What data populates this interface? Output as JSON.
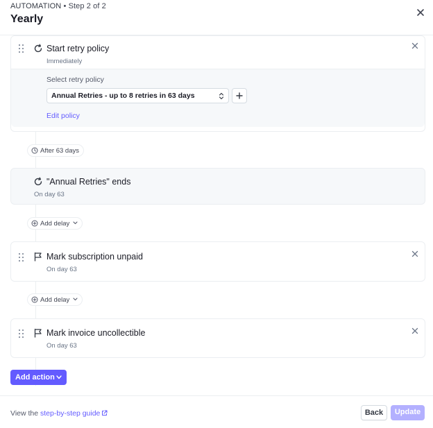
{
  "header": {
    "eyebrow_label": "AUTOMATION",
    "eyebrow_step": "• Step 2 of 2",
    "title": "Yearly"
  },
  "steps": {
    "retry": {
      "title": "Start retry policy",
      "subtitle": "Immediately",
      "select_label": "Select retry policy",
      "select_value": "Annual Retries - up to 8 retries in 63 days",
      "edit_link": "Edit policy"
    },
    "delay_pill": "After 63 days",
    "retry_end": {
      "title": "\"Annual Retries\" ends",
      "subtitle": "On day 63"
    },
    "add_delay_1": "Add delay",
    "unpaid": {
      "title": "Mark subscription unpaid",
      "subtitle": "On day 63"
    },
    "add_delay_2": "Add delay",
    "uncollectible": {
      "title": "Mark invoice uncollectible",
      "subtitle": "On day 63"
    }
  },
  "add_action_label": "Add action",
  "footer": {
    "prefix": "View the",
    "link": "step-by-step guide",
    "back_label": "Back",
    "update_label": "Update"
  },
  "colors": {
    "accent": "#635bff",
    "update_disabled": "#b3b0ff",
    "border": "#ebeef1"
  },
  "icons": [
    "close-icon",
    "drag-handle-icon",
    "retry-icon",
    "flag-icon",
    "clock-icon",
    "plus-circle-icon",
    "chevron-down-icon",
    "select-chevrons-icon",
    "plus-icon",
    "external-link-icon"
  ]
}
